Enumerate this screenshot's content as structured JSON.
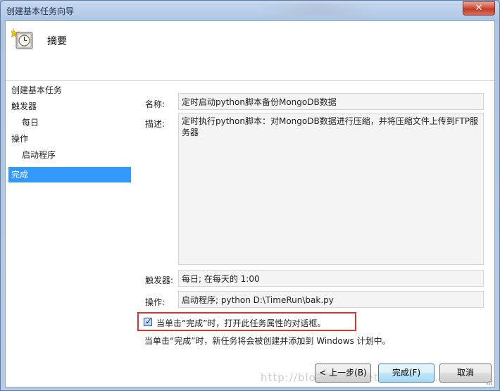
{
  "window": {
    "title": "创建基本任务向导",
    "close_label": "✕"
  },
  "header": {
    "title": "摘要",
    "icon": "clock-icon"
  },
  "sidebar": {
    "items": [
      {
        "label": "创建基本任务",
        "level": 0,
        "selected": false
      },
      {
        "label": "触发器",
        "level": 0,
        "selected": false
      },
      {
        "label": "每日",
        "level": 1,
        "selected": false
      },
      {
        "label": "操作",
        "level": 0,
        "selected": false
      },
      {
        "label": "启动程序",
        "level": 1,
        "selected": false
      },
      {
        "label": "完成",
        "level": 0,
        "selected": true
      }
    ]
  },
  "summary": {
    "name_label": "名称:",
    "name_value": "定时启动python脚本备份MongoDB数据",
    "desc_label": "描述:",
    "desc_value": "定时执行python脚本：对MongoDB数据进行压缩，并将压缩文件上传到FTP服务器",
    "trigger_label": "触发器:",
    "trigger_value": "每日; 在每天的 1:00",
    "action_label": "操作:",
    "action_value": "启动程序; python D:\\TimeRun\\bak.py"
  },
  "options": {
    "open_properties_checked": true,
    "open_properties_label": "当单击“完成”时，打开此任务属性的对话框。",
    "info_text": "当单击“完成”时，新任务将会被创建并添加到 Windows 计划中。"
  },
  "buttons": {
    "back_label": "< 上一步(B)",
    "finish_label": "完成(F)",
    "cancel_label": "取消"
  },
  "watermark": "http://blog.csdn.net/u013023..."
}
